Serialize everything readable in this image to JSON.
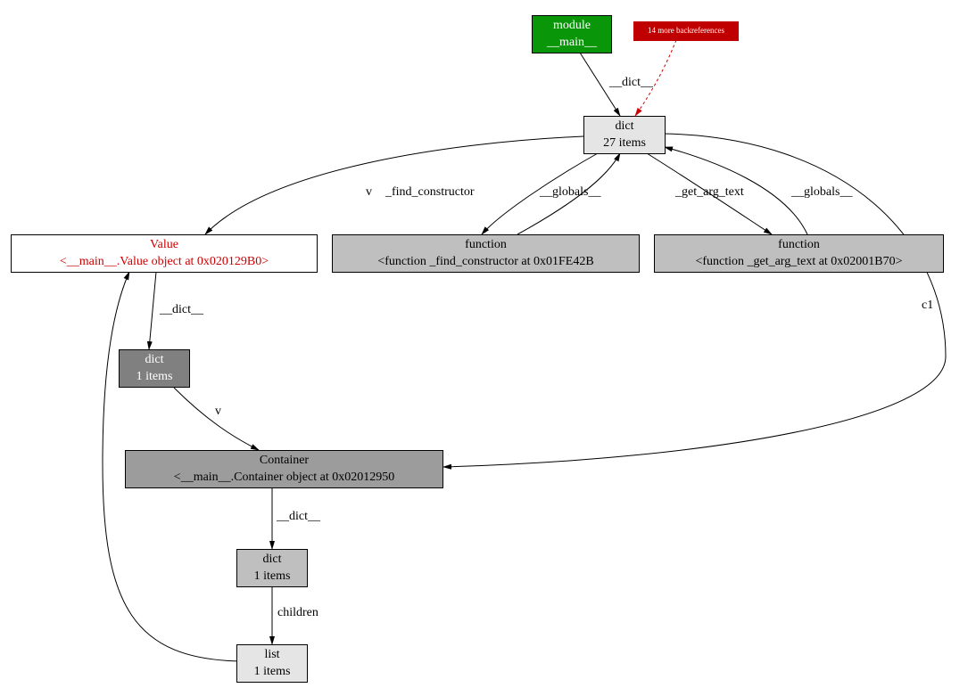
{
  "nodes": {
    "module": {
      "l1": "module",
      "l2": "__main__"
    },
    "backref": {
      "text": "14 more backreferences"
    },
    "dict27": {
      "l1": "dict",
      "l2": "27 items"
    },
    "value": {
      "l1": "Value",
      "l2": "<__main__.Value object at 0x020129B0>"
    },
    "func1": {
      "l1": "function",
      "l2": "<function _find_constructor at 0x01FE42B"
    },
    "func2": {
      "l1": "function",
      "l2": "<function _get_arg_text at 0x02001B70>"
    },
    "dict1a": {
      "l1": "dict",
      "l2": "1 items"
    },
    "container": {
      "l1": "Container",
      "l2": "<__main__.Container object at 0x02012950"
    },
    "dict1b": {
      "l1": "dict",
      "l2": "1 items"
    },
    "list1": {
      "l1": "list",
      "l2": "1 items"
    }
  },
  "edges": {
    "e1": "__dict__",
    "e2": "v",
    "e3": "_find_constructor",
    "e4": "__globals__",
    "e5": "_get_arg_text",
    "e6": "__globals__",
    "e7": "__dict__",
    "e8": "c1",
    "e9": "v",
    "e10": "__dict__",
    "e11": "children"
  }
}
